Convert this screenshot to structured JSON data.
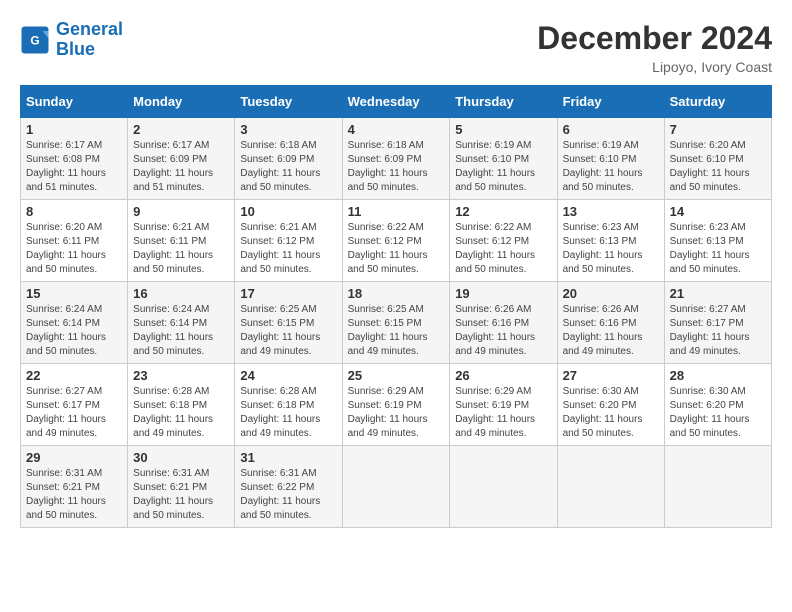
{
  "header": {
    "logo_line1": "General",
    "logo_line2": "Blue",
    "main_title": "December 2024",
    "subtitle": "Lipoyo, Ivory Coast"
  },
  "days_of_week": [
    "Sunday",
    "Monday",
    "Tuesday",
    "Wednesday",
    "Thursday",
    "Friday",
    "Saturday"
  ],
  "weeks": [
    [
      {
        "day": "1",
        "info": "Sunrise: 6:17 AM\nSunset: 6:08 PM\nDaylight: 11 hours\nand 51 minutes."
      },
      {
        "day": "2",
        "info": "Sunrise: 6:17 AM\nSunset: 6:09 PM\nDaylight: 11 hours\nand 51 minutes."
      },
      {
        "day": "3",
        "info": "Sunrise: 6:18 AM\nSunset: 6:09 PM\nDaylight: 11 hours\nand 50 minutes."
      },
      {
        "day": "4",
        "info": "Sunrise: 6:18 AM\nSunset: 6:09 PM\nDaylight: 11 hours\nand 50 minutes."
      },
      {
        "day": "5",
        "info": "Sunrise: 6:19 AM\nSunset: 6:10 PM\nDaylight: 11 hours\nand 50 minutes."
      },
      {
        "day": "6",
        "info": "Sunrise: 6:19 AM\nSunset: 6:10 PM\nDaylight: 11 hours\nand 50 minutes."
      },
      {
        "day": "7",
        "info": "Sunrise: 6:20 AM\nSunset: 6:10 PM\nDaylight: 11 hours\nand 50 minutes."
      }
    ],
    [
      {
        "day": "8",
        "info": "Sunrise: 6:20 AM\nSunset: 6:11 PM\nDaylight: 11 hours\nand 50 minutes."
      },
      {
        "day": "9",
        "info": "Sunrise: 6:21 AM\nSunset: 6:11 PM\nDaylight: 11 hours\nand 50 minutes."
      },
      {
        "day": "10",
        "info": "Sunrise: 6:21 AM\nSunset: 6:12 PM\nDaylight: 11 hours\nand 50 minutes."
      },
      {
        "day": "11",
        "info": "Sunrise: 6:22 AM\nSunset: 6:12 PM\nDaylight: 11 hours\nand 50 minutes."
      },
      {
        "day": "12",
        "info": "Sunrise: 6:22 AM\nSunset: 6:12 PM\nDaylight: 11 hours\nand 50 minutes."
      },
      {
        "day": "13",
        "info": "Sunrise: 6:23 AM\nSunset: 6:13 PM\nDaylight: 11 hours\nand 50 minutes."
      },
      {
        "day": "14",
        "info": "Sunrise: 6:23 AM\nSunset: 6:13 PM\nDaylight: 11 hours\nand 50 minutes."
      }
    ],
    [
      {
        "day": "15",
        "info": "Sunrise: 6:24 AM\nSunset: 6:14 PM\nDaylight: 11 hours\nand 50 minutes."
      },
      {
        "day": "16",
        "info": "Sunrise: 6:24 AM\nSunset: 6:14 PM\nDaylight: 11 hours\nand 50 minutes."
      },
      {
        "day": "17",
        "info": "Sunrise: 6:25 AM\nSunset: 6:15 PM\nDaylight: 11 hours\nand 49 minutes."
      },
      {
        "day": "18",
        "info": "Sunrise: 6:25 AM\nSunset: 6:15 PM\nDaylight: 11 hours\nand 49 minutes."
      },
      {
        "day": "19",
        "info": "Sunrise: 6:26 AM\nSunset: 6:16 PM\nDaylight: 11 hours\nand 49 minutes."
      },
      {
        "day": "20",
        "info": "Sunrise: 6:26 AM\nSunset: 6:16 PM\nDaylight: 11 hours\nand 49 minutes."
      },
      {
        "day": "21",
        "info": "Sunrise: 6:27 AM\nSunset: 6:17 PM\nDaylight: 11 hours\nand 49 minutes."
      }
    ],
    [
      {
        "day": "22",
        "info": "Sunrise: 6:27 AM\nSunset: 6:17 PM\nDaylight: 11 hours\nand 49 minutes."
      },
      {
        "day": "23",
        "info": "Sunrise: 6:28 AM\nSunset: 6:18 PM\nDaylight: 11 hours\nand 49 minutes."
      },
      {
        "day": "24",
        "info": "Sunrise: 6:28 AM\nSunset: 6:18 PM\nDaylight: 11 hours\nand 49 minutes."
      },
      {
        "day": "25",
        "info": "Sunrise: 6:29 AM\nSunset: 6:19 PM\nDaylight: 11 hours\nand 49 minutes."
      },
      {
        "day": "26",
        "info": "Sunrise: 6:29 AM\nSunset: 6:19 PM\nDaylight: 11 hours\nand 49 minutes."
      },
      {
        "day": "27",
        "info": "Sunrise: 6:30 AM\nSunset: 6:20 PM\nDaylight: 11 hours\nand 50 minutes."
      },
      {
        "day": "28",
        "info": "Sunrise: 6:30 AM\nSunset: 6:20 PM\nDaylight: 11 hours\nand 50 minutes."
      }
    ],
    [
      {
        "day": "29",
        "info": "Sunrise: 6:31 AM\nSunset: 6:21 PM\nDaylight: 11 hours\nand 50 minutes."
      },
      {
        "day": "30",
        "info": "Sunrise: 6:31 AM\nSunset: 6:21 PM\nDaylight: 11 hours\nand 50 minutes."
      },
      {
        "day": "31",
        "info": "Sunrise: 6:31 AM\nSunset: 6:22 PM\nDaylight: 11 hours\nand 50 minutes."
      },
      {
        "day": "",
        "info": ""
      },
      {
        "day": "",
        "info": ""
      },
      {
        "day": "",
        "info": ""
      },
      {
        "day": "",
        "info": ""
      }
    ]
  ]
}
